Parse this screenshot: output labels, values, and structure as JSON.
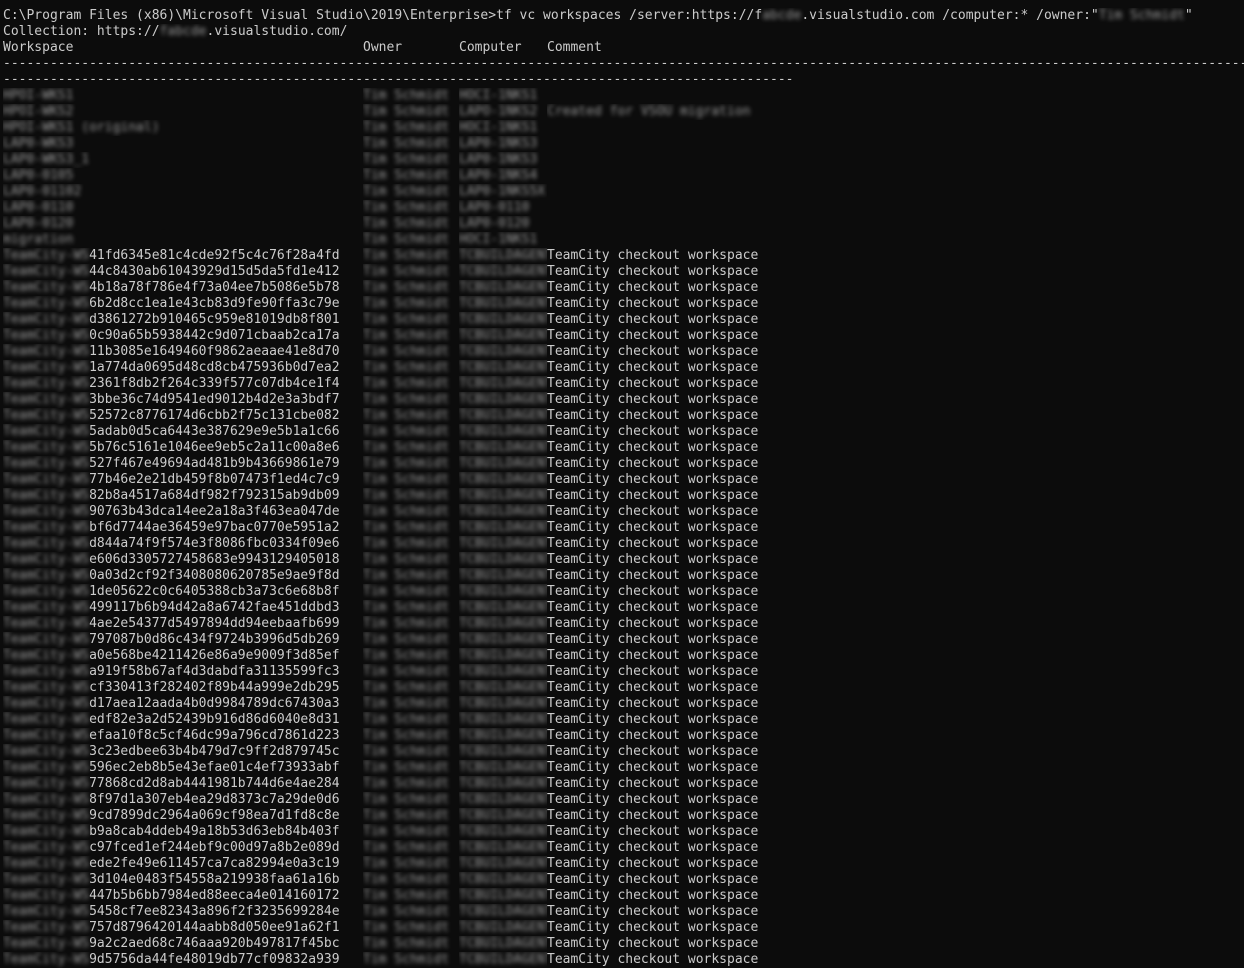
{
  "console": {
    "command_prefix": "C:\\Program Files (x86)\\Microsoft Visual Studio\\2019\\Enterprise>tf vc workspaces /server:https://f",
    "command_server_redacted": "abcde",
    "command_mid": ".visualstudio.com /computer:* /owner:\"",
    "command_owner_redacted": "Tim Schmidt",
    "command_suffix": "\"",
    "collection_prefix": "Collection: https://",
    "collection_redacted": "fabcde",
    "collection_suffix": ".visualstudio.com/",
    "headers": {
      "workspace": "Workspace",
      "owner": "Owner",
      "computer": "Computer",
      "comment": "Comment"
    },
    "separator_line": "------------------------------------------------------------------------------------------------------------------------------------------------------------------------------------------------------------------------------------------------------",
    "separator_wrap": "-----------------------------------------------------------------------------------------------------"
  },
  "owner_blurred": "Tim Schmidt",
  "computer_blurred_teamcity": "TCBUILDAGENT",
  "comment_teamcity": "TeamCity checkout workspace",
  "workspace_prefix_blurred": "TeamCity-WS",
  "named_workspaces": [
    {
      "name": "HPOI-WKS1",
      "computer": "HOCI-1NKS1",
      "comment": ""
    },
    {
      "name": "HPOI-WKS2",
      "computer": "LAPO-1NKS2",
      "comment": "Created for VSOU migration"
    },
    {
      "name": "HPOI-WKS1 (original)",
      "computer": "HOCI-1NKS1",
      "comment": ""
    },
    {
      "name": "LAP0-WKS3",
      "computer": "LAP0-1NKS3",
      "comment": ""
    },
    {
      "name": "LAP0-WKS3_1",
      "computer": "LAP0-1NKS3",
      "comment": ""
    },
    {
      "name": "LAP0-0105",
      "computer": "LAP0-1NKS4",
      "comment": ""
    },
    {
      "name": "LAP0-01102",
      "computer": "LAP0-1NKS5X",
      "comment": ""
    },
    {
      "name": "LAP0-0110",
      "computer": "LAP0-0110",
      "comment": ""
    },
    {
      "name": "LAP0-0120",
      "computer": "LAP0-0120",
      "comment": ""
    },
    {
      "name": "migration",
      "computer": "HOCI-1NKS1",
      "comment": ""
    }
  ],
  "teamcity_hashes": [
    "41fd6345e81c4cde92f5c4c76f28a4fd",
    "44c8430ab61043929d15d5da5fd1e412",
    "4b18a78f786e4f73a04ee7b5086e5b78",
    "6b2d8cc1ea1e43cb83d9fe90ffa3c79e",
    "d3861272b910465c959e81019db8f801",
    "0c90a65b5938442c9d071cbaab2ca17a",
    "11b3085e1649460f9862aeaae41e8d70",
    "1a774da0695d48cd8cb475936b0d7ea2",
    "2361f8db2f264c339f577c07db4ce1f4",
    "3bbe36c74d9541ed9012b4d2e3a3bdf7",
    "52572c8776174d6cbb2f75c131cbe082",
    "5adab0d5ca6443e387629e9e5b1a1c66",
    "5b76c5161e1046ee9eb5c2a11c00a8e6",
    "527f467e49694ad481b9b43669861e79",
    "77b46e2e21db459f8b07473f1ed4c7c9",
    "82b8a4517a684df982f792315ab9db09",
    "90763b43dca14ee2a18a3f463ea047de",
    "bf6d7744ae36459e97bac0770e5951a2",
    "d844a74f9f574e3f8086fbc0334f09e6",
    "e606d3305727458683e9943129405018",
    "0a03d2cf92f3408080620785e9ae9f8d",
    "1de05622c0c6405388cb3a73c6e68b8f",
    "499117b6b94d42a8a6742fae451ddbd3",
    "4ae2e54377d5497894dd94eebaafb699",
    "797087b0d86c434f9724b3996d5db269",
    "a0e568be4211426e86a9e9009f3d85ef",
    "a919f58b67af4d3dabdfa31135599fc3",
    "cf330413f282402f89b44a999e2db295",
    "d17aea12aada4b0d9984789dc67430a3",
    "edf82e3a2d52439b916d86d6040e8d31",
    "efaa10f8c5cf46dc99a796cd7861d223",
    "3c23edbee63b4b479d7c9ff2d879745c",
    "596ec2eb8b5e43efae01c4ef73933abf",
    "77868cd2d8ab4441981b744d6e4ae284",
    "8f97d1a307eb4ea29d8373c7a29de0d6",
    "9cd7899dc2964a069cf98ea7d1fd8c8e",
    "b9a8cab4ddeb49a18b53d63eb84b403f",
    "c97fced1ef244ebf9c00d97a8b2e089d",
    "ede2fe49e611457ca7ca82994e0a3c19",
    "3d104e0483f54558a219938faa61a16b",
    "447b5b6bb7984ed88eeca4e014160172",
    "5458cf7ee82343a896f2f3235699284e",
    "757d8796420144aabb8d050ee91a62f1",
    "9a2c2aed68c746aaa920b497817f45bc",
    "9d5756da44fe48019db77cf09832a939"
  ]
}
